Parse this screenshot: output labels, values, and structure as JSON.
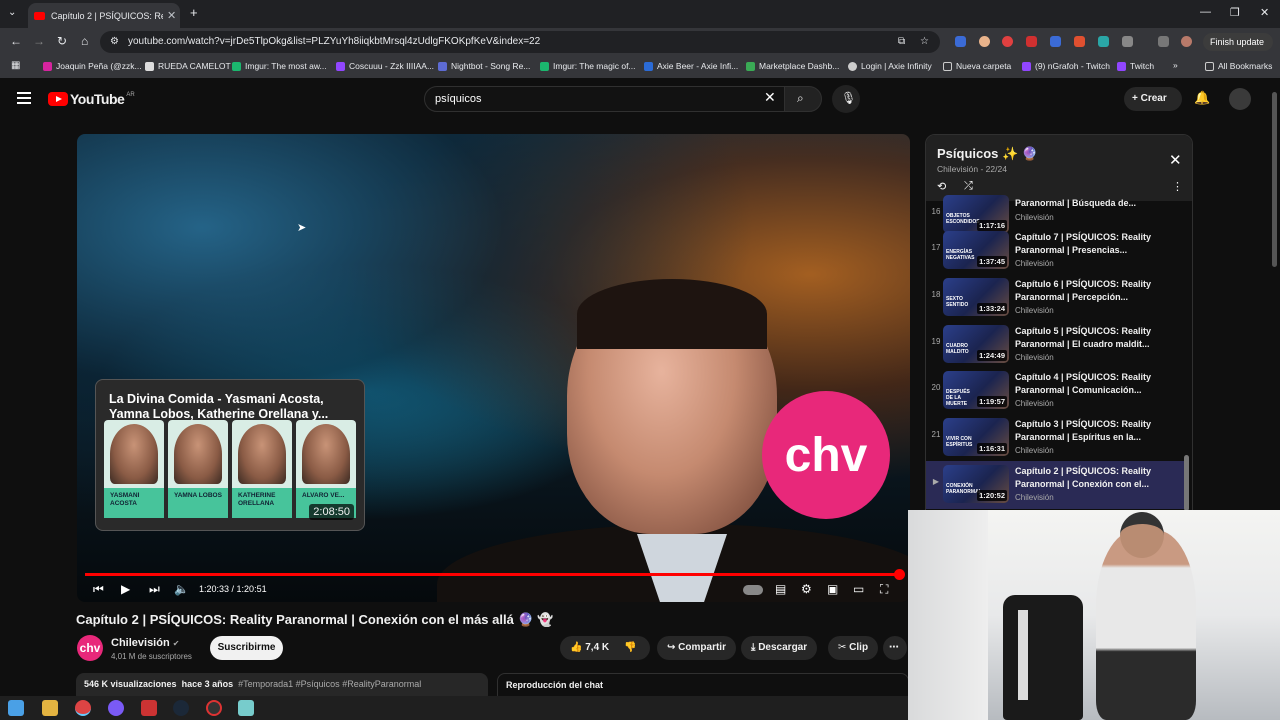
{
  "browser": {
    "tab_title": "Capítulo 2 | PSÍQUICOS: Reality",
    "url": "youtube.com/watch?v=jrDe5TlpOkg&list=PLZYuYh8iiqkbtMrsql4zUdlgFKOKpfKeV&index=22",
    "finish_update": "Finish update",
    "all_bookmarks": "All Bookmarks",
    "bookmarks": [
      "Joaquin Peña (@zzk...",
      "RUEDA CAMELOT",
      "Imgur: The most aw...",
      "Coscuuu - Zzk IIIIAA...",
      "Nightbot - Song Re...",
      "Imgur: The magic of...",
      "Axie Beer - Axie Infi...",
      "Marketplace Dashb...",
      "Login | Axie Infinity",
      "Nueva carpeta",
      "(9) nGrafoh - Twitch",
      "Twitch"
    ]
  },
  "youtube": {
    "logo_text": "YouTube",
    "region": "AR",
    "search_value": "psíquicos",
    "create_label": "Crear"
  },
  "video": {
    "endcard_title": "La Divina Comida - Yasmani Acosta, Yamna Lobos, Katherine Orellana y...",
    "endcard_duration": "2:08:50",
    "guests": [
      "YASMANI ACOSTA",
      "YAMNA LOBOS",
      "KATHERINE ORELLANA",
      "ALVARO VE..."
    ],
    "time_current": "1:20:33",
    "time_total": "1:20:51",
    "progress": 0.996,
    "title": "Capítulo 2 | PSÍQUICOS: Reality Paranormal | Conexión con el más allá 🔮 👻",
    "channel_name": "Chilevisión",
    "channel_subs": "4,01 M de suscriptores",
    "subscribe_label": "Suscribirme",
    "likes": "7,4 K",
    "share_label": "Compartir",
    "download_label": "Descargar",
    "clip_label": "Clip",
    "views": "546 K visualizaciones",
    "posted": "hace 3 años",
    "hashtags": "#Temporada1 #Psíquicos #RealityParanormal",
    "chat_replay": "Reproducción del chat"
  },
  "playlist": {
    "title": "Psíquicos ✨ 🔮",
    "subtitle": "Chilevisión - 22/24",
    "items": [
      {
        "index": "16",
        "title": "Paranormal | Búsqueda de...",
        "channel": "Chilevisión",
        "duration": "1:17:16",
        "thumb_label": "OBJETOS ESCONDIDOS"
      },
      {
        "index": "17",
        "title": "Capítulo 7 | PSÍQUICOS: Reality Paranormal | Presencias...",
        "channel": "Chilevisión",
        "duration": "1:37:45",
        "thumb_label": "ENERGÍAS NEGATIVAS"
      },
      {
        "index": "18",
        "title": "Capítulo 6 | PSÍQUICOS: Reality Paranormal | Percepción...",
        "channel": "Chilevisión",
        "duration": "1:33:24",
        "thumb_label": "SEXTO SENTIDO"
      },
      {
        "index": "19",
        "title": "Capítulo 5 | PSÍQUICOS: Reality Paranormal | El cuadro maldit...",
        "channel": "Chilevisión",
        "duration": "1:24:49",
        "thumb_label": "CUADRO MALDITO"
      },
      {
        "index": "20",
        "title": "Capítulo 4 | PSÍQUICOS: Reality Paranormal | Comunicación...",
        "channel": "Chilevisión",
        "duration": "1:19:57",
        "thumb_label": "DESPUÉS DE LA MUERTE"
      },
      {
        "index": "21",
        "title": "Capítulo 3 | PSÍQUICOS: Reality Paranormal | Espíritus en la...",
        "channel": "Chilevisión",
        "duration": "1:16:31",
        "thumb_label": "VIVIR CON ESPÍRITUS"
      },
      {
        "index": "▶",
        "title": "Capítulo 2 | PSÍQUICOS: Reality Paranormal | Conexión con el...",
        "channel": "Chilevisión",
        "duration": "1:20:52",
        "thumb_label": "CONEXIÓN PARANORMAL"
      }
    ]
  },
  "colors": {
    "accent": "#ff0000",
    "brand": "#e8287a",
    "active_row": "#2a2a55"
  }
}
